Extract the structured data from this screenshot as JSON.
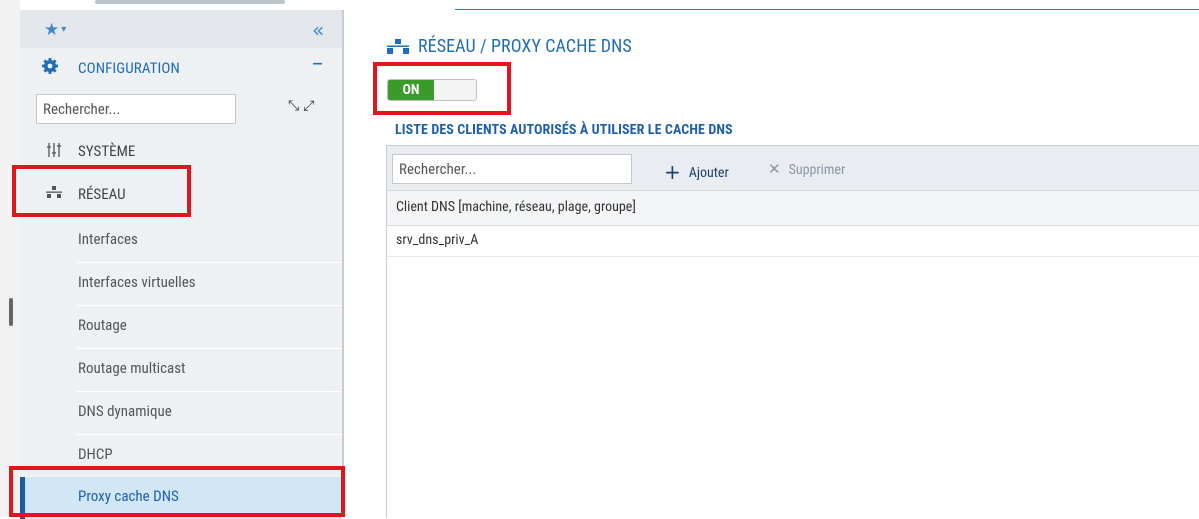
{
  "sidebar": {
    "config_label": "CONFIGURATION",
    "search_placeholder": "Rechercher...",
    "sections": [
      {
        "label": "SYSTÈME",
        "icon": "sliders-icon"
      },
      {
        "label": "RÉSEAU",
        "icon": "network-icon"
      }
    ],
    "items": [
      {
        "label": "Interfaces"
      },
      {
        "label": "Interfaces virtuelles"
      },
      {
        "label": "Routage"
      },
      {
        "label": "Routage multicast"
      },
      {
        "label": "DNS dynamique"
      },
      {
        "label": "DHCP"
      },
      {
        "label": "Proxy cache DNS",
        "active": true
      }
    ]
  },
  "page": {
    "title": "RÉSEAU / PROXY CACHE DNS",
    "toggle_label": "ON",
    "section_title": "LISTE DES CLIENTS AUTORISÉS À UTILISER LE CACHE DNS"
  },
  "toolbar": {
    "search_placeholder": "Rechercher...",
    "add_label": "Ajouter",
    "delete_label": "Supprimer"
  },
  "table": {
    "column_header": "Client DNS [machine, réseau, plage, groupe]",
    "rows": [
      "srv_dns_priv_A"
    ]
  },
  "colors": {
    "accent": "#1f6db8",
    "toggle_on": "#3a9a2a",
    "highlight": "#e0161d",
    "active_item_bg": "#d2e7f6"
  }
}
